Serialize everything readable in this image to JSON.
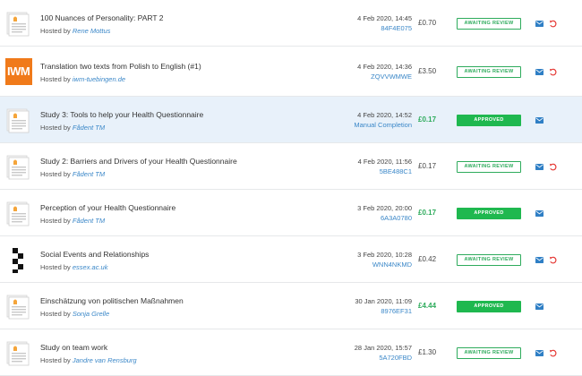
{
  "colors": {
    "link": "#3a87c8",
    "green": "#2eab5c",
    "approved_bg": "#1fb84f",
    "highlight_bg": "#e8f1fa",
    "undo": "#e53935",
    "mail": "#2f7fc5"
  },
  "submissions": [
    {
      "title": "100 Nuances of Personality: PART 2",
      "hosted_prefix": "Hosted by",
      "host": "Rene Mottus",
      "date": "4 Feb 2020, 14:45",
      "code": "84F4E075",
      "reward": "£0.70",
      "reward_bonus": false,
      "status": "AWAITING REVIEW",
      "approved": false,
      "thumb": "document-icon",
      "undo": true,
      "highlight": false
    },
    {
      "title": "Translation two texts from Polish to English (#1)",
      "hosted_prefix": "Hosted by",
      "host": "iwm-tuebingen.de",
      "date": "4 Feb 2020, 14:36",
      "code": "ZQVVWMWE",
      "reward": "£3.50",
      "reward_bonus": false,
      "status": "AWAITING REVIEW",
      "approved": false,
      "thumb": "iwm-logo",
      "thumb_text": "IWM",
      "undo": true,
      "highlight": false
    },
    {
      "title": "Study 3: Tools to help your Health Questionnaire",
      "hosted_prefix": "Hosted by",
      "host": "Fådent TM",
      "date": "4 Feb 2020, 14:52",
      "code": "Manual Completion",
      "reward": "£0.17",
      "reward_bonus": true,
      "status": "APPROVED",
      "approved": true,
      "thumb": "document-icon",
      "undo": false,
      "highlight": true
    },
    {
      "title": "Study 2: Barriers and Drivers of your Health Questionnaire",
      "hosted_prefix": "Hosted by",
      "host": "Fådent TM",
      "date": "4 Feb 2020, 11:56",
      "code": "5BE488C1",
      "reward": "£0.17",
      "reward_bonus": false,
      "status": "AWAITING REVIEW",
      "approved": false,
      "thumb": "document-icon",
      "undo": true,
      "highlight": false
    },
    {
      "title": "Perception of your Health Questionnaire",
      "hosted_prefix": "Hosted by",
      "host": "Fådent TM",
      "date": "3 Feb 2020, 20:00",
      "code": "6A3A0780",
      "reward": "£0.17",
      "reward_bonus": true,
      "status": "APPROVED",
      "approved": true,
      "thumb": "document-icon",
      "undo": false,
      "highlight": false
    },
    {
      "title": "Social Events and Relationships",
      "hosted_prefix": "Hosted by",
      "host": "essex.ac.uk",
      "date": "3 Feb 2020, 10:28",
      "code": "WNN4NKMD",
      "reward": "£0.42",
      "reward_bonus": false,
      "status": "AWAITING REVIEW",
      "approved": false,
      "thumb": "checker-logo",
      "undo": true,
      "highlight": false
    },
    {
      "title": "Einschätzung von politischen Maßnahmen",
      "hosted_prefix": "Hosted by",
      "host": "Sonja Grelle",
      "date": "30 Jan 2020, 11:09",
      "code": "8976EF31",
      "reward": "£4.44",
      "reward_bonus": true,
      "status": "APPROVED",
      "approved": true,
      "thumb": "document-icon",
      "undo": false,
      "highlight": false
    },
    {
      "title": "Study on team work",
      "hosted_prefix": "Hosted by",
      "host": "Jandre van Rensburg",
      "date": "28 Jan 2020, 15:57",
      "code": "5A720FBD",
      "reward": "£1.30",
      "reward_bonus": false,
      "status": "AWAITING REVIEW",
      "approved": false,
      "thumb": "document-icon",
      "undo": true,
      "highlight": false
    }
  ]
}
